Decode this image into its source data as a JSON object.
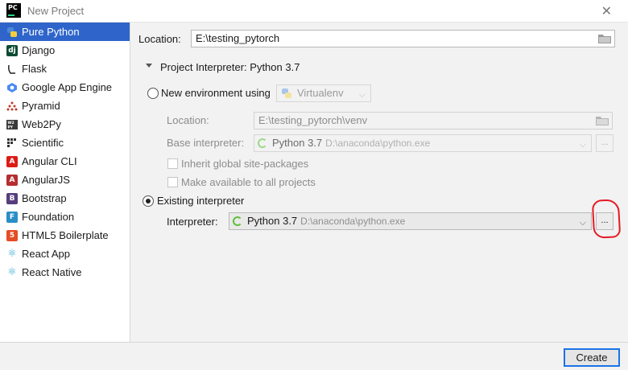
{
  "window": {
    "title": "New Project",
    "app_icon_text": "PC"
  },
  "sidebar": {
    "items": [
      {
        "label": "Pure Python",
        "icon": "python-icon",
        "glyph": ""
      },
      {
        "label": "Django",
        "icon": "django-icon",
        "glyph": "dj"
      },
      {
        "label": "Flask",
        "icon": "flask-icon",
        "glyph": ""
      },
      {
        "label": "Google App Engine",
        "icon": "google-app-engine-icon",
        "glyph": ""
      },
      {
        "label": "Pyramid",
        "icon": "pyramid-icon",
        "glyph": ""
      },
      {
        "label": "Web2Py",
        "icon": "web2py-icon",
        "glyph": ""
      },
      {
        "label": "Scientific",
        "icon": "scientific-icon",
        "glyph": ""
      },
      {
        "label": "Angular CLI",
        "icon": "angular-icon",
        "glyph": "A"
      },
      {
        "label": "AngularJS",
        "icon": "angularjs-icon",
        "glyph": "A"
      },
      {
        "label": "Bootstrap",
        "icon": "bootstrap-icon",
        "glyph": "B"
      },
      {
        "label": "Foundation",
        "icon": "foundation-icon",
        "glyph": "F"
      },
      {
        "label": "HTML5 Boilerplate",
        "icon": "html5-icon",
        "glyph": "5"
      },
      {
        "label": "React App",
        "icon": "react-icon",
        "glyph": "⚛"
      },
      {
        "label": "React Native",
        "icon": "react-native-icon",
        "glyph": "⚛"
      }
    ]
  },
  "main": {
    "location_label": "Location:",
    "location_value": "E:\\testing_pytorch",
    "interpreter_section_title": "Project Interpreter: Python 3.7",
    "new_env": {
      "radio_label": "New environment using",
      "tool_value": "Virtualenv",
      "location_label": "Location:",
      "location_value": "E:\\testing_pytorch\\venv",
      "base_label": "Base interpreter:",
      "base_name": "Python 3.7",
      "base_path": "D:\\anaconda\\python.exe",
      "inherit_label": "Inherit global site-packages",
      "available_label": "Make available to all projects",
      "browse_label": "..."
    },
    "existing": {
      "radio_label": "Existing interpreter",
      "interpreter_label": "Interpreter:",
      "interpreter_name": "Python 3.7",
      "interpreter_path": "D:\\anaconda\\python.exe",
      "browse_label": "..."
    }
  },
  "footer": {
    "create_label": "Create"
  },
  "colors": {
    "selection": "#2f65ca",
    "annotation": "#e41b23",
    "focus": "#1b73e8"
  }
}
